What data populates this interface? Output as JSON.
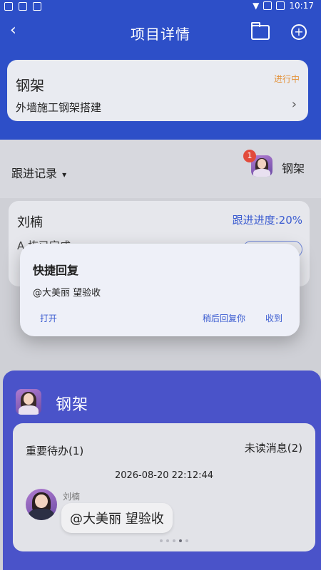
{
  "status_bar": {
    "time": "10:17"
  },
  "header": {
    "title": "项目详情"
  },
  "project": {
    "name": "钢架",
    "status": "进行中",
    "description": "外墙施工钢架搭建"
  },
  "records": {
    "label": "跟进记录",
    "badge_count": "1",
    "user_label": "钢架"
  },
  "record_card": {
    "name": "刘楠",
    "progress": "跟进进度:20%",
    "line1": "A 栋已完成"
  },
  "popup": {
    "title": "快捷回复",
    "message": "@大美丽 望验收",
    "open_label": "打开",
    "later_label": "稍后回复你",
    "received_label": "收到"
  },
  "chat": {
    "title": "钢架",
    "todo_label": "重要待办(1)",
    "unread_label": "未读消息(2)",
    "time": "2026-08-20 22:12:44",
    "sender": "刘楠",
    "message": "@大美丽 望验收"
  },
  "colors": {
    "header_bg": "#2d4fc8",
    "accent": "#3a5bd0",
    "status_orange": "#e3923b",
    "chat_bg": "#4a53c9",
    "badge_red": "#e24b3b"
  }
}
